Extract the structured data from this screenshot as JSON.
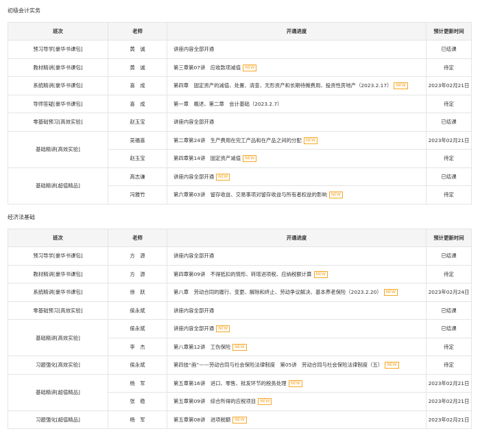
{
  "sections": [
    {
      "title": "初级会计实务",
      "headers": [
        "班次",
        "老师",
        "开通进度",
        "预计更新时间"
      ],
      "rows": [
        {
          "class": "预习导学[豪华书课包]",
          "teacher": "黄　诚",
          "progress": "讲座内容全部开通",
          "new": false,
          "time": "已结课"
        },
        {
          "class": "教材精讲[豪华书课包]",
          "teacher": "黄　诚",
          "progress": "第三章第07讲　应收款项减值",
          "new": true,
          "time": "待定"
        },
        {
          "class": "系统精讲[豪华书课包]",
          "teacher": "喜　成",
          "progress": "第四章　固定资产的减值、处置、清查、无形资产和长期待摊费用、投资性房地产（2023.2.17）",
          "new": true,
          "time": "2023年02月21日"
        },
        {
          "class": "导师答疑[豪华书课包]",
          "teacher": "喜　成",
          "progress": "第一章　概述、第二章　会计基础（2023.2.7）",
          "new": false,
          "time": "待定"
        },
        {
          "class": "零基础预习[高效实验]",
          "teacher": "赵玉宝",
          "progress": "讲座内容全部开通",
          "new": false,
          "time": "已结课"
        },
        {
          "class": "基础精讲[高效实验]",
          "teacher": "吴福喜",
          "progress": "第二章第24讲　生产费用在完工产品和在产品之间的分配",
          "new": true,
          "time": "2023年02月21日"
        },
        {
          "class": "",
          "teacher": "赵玉宝",
          "progress": "第四章第14讲　固定资产减值",
          "new": true,
          "time": "待定"
        },
        {
          "class": "基础精讲[超值精品]",
          "teacher": "高志谦",
          "progress": "讲座内容全部开通",
          "new": true,
          "time": "已结课"
        },
        {
          "class": "",
          "teacher": "冯雅竹",
          "progress": "第六章第03讲　留存收益、交易事项对留存收益与所有者权益的影响",
          "new": true,
          "time": "待定"
        }
      ]
    },
    {
      "title": "经济法基础",
      "headers": [
        "班次",
        "老师",
        "开通进度",
        "预计更新时间"
      ],
      "rows": [
        {
          "class": "预习导学[豪华书课包]",
          "teacher": "方　源",
          "progress": "讲座内容全部开通",
          "new": false,
          "time": "已结课"
        },
        {
          "class": "教材精讲[豪华书课包]",
          "teacher": "方　源",
          "progress": "第四章第09讲　不得抵扣的情形、转增进项税、应纳税额计算",
          "new": true,
          "time": "待定"
        },
        {
          "class": "系统精讲[豪华书课包]",
          "teacher": "徐　跃",
          "progress": "第八章　劳动合同的履行、变更、解除和终止、劳动争议解决、基本养老保险（2023.2.20）",
          "new": true,
          "time": "2023年02月24日"
        },
        {
          "class": "零基础预习[高效实验]",
          "teacher": "侯永斌",
          "progress": "讲座内容全部开通",
          "new": false,
          "time": "已结课"
        },
        {
          "class": "基础精讲[高效实验]",
          "teacher": "侯永斌",
          "progress": "讲座内容全部开通",
          "new": true,
          "time": "已结课"
        },
        {
          "class": "",
          "teacher": "李　杰",
          "progress": "第八章第12讲　工伤保险",
          "new": true,
          "time": "待定"
        },
        {
          "class": "习题强化[高效实验]",
          "teacher": "侯永斌",
          "progress": "第四技“画”——劳动合同与社会保险法律制度　第05讲　劳动合同与社会保险法律制度（五）",
          "new": true,
          "time": "待定"
        },
        {
          "class": "基础精讲[超值精品]",
          "teacher": "杨　军",
          "progress": "第五章第16讲　进口、零售、批发环节的税务处理",
          "new": true,
          "time": "2023年02月21日"
        },
        {
          "class": "",
          "teacher": "张　稳",
          "progress": "第五章第09讲　综合所得的应税项目",
          "new": true,
          "time": "2023年02月21日"
        },
        {
          "class": "习题强化[超值精品]",
          "teacher": "杨　军",
          "progress": "第五章第08讲　进项税额",
          "new": true,
          "time": "2023年02月21日"
        }
      ]
    }
  ],
  "new_label": "NEW",
  "colors": {
    "accent": "#f5a623",
    "header_bg": "#f5f5f5",
    "border": "#e4e4e4"
  }
}
